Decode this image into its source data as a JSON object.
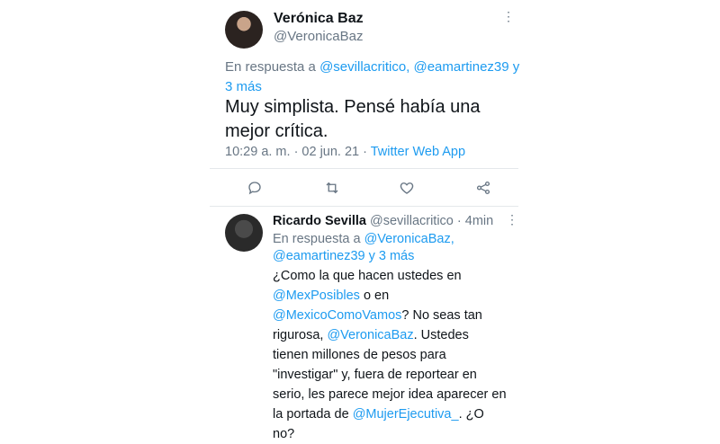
{
  "main_tweet": {
    "name": "Verónica Baz",
    "handle": "@VeronicaBaz",
    "reply_prefix": "En respuesta a ",
    "reply_mentions": "@sevillacritico, @eamartinez39 y 3 más",
    "text": "Muy simplista. Pensé había una mejor crítica.",
    "time": "10:29 a. m. · 02 jun. 21 · ",
    "source": "Twitter Web App"
  },
  "reply_tweet": {
    "name": "Ricardo Sevilla",
    "handle": "@sevillacritico",
    "age": " · 4min",
    "reply_prefix": "En respuesta a ",
    "reply_mentions": "@VeronicaBaz, @eamartinez39 y 3 más",
    "text_1": "¿Como la que hacen ustedes en ",
    "mention_1": "@MexPosibles",
    "text_2": " o en ",
    "mention_2": "@MexicoComoVamos",
    "text_3": "? No seas tan rigurosa, ",
    "mention_3": "@VeronicaBaz",
    "text_4": ". Ustedes tienen millones de pesos para \"investigar\" y, fuera de reportear en serio, les parece mejor idea aparecer en la portada de ",
    "mention_4": "@MujerEjecutiva_",
    "text_5": ". ¿O no?"
  },
  "icons": [
    "more-vertical-icon",
    "reply-icon",
    "retweet-icon",
    "like-icon",
    "share-icon"
  ],
  "colors": {
    "link": "#1d9bf0",
    "muted": "#687684",
    "text": "#0f1419"
  }
}
